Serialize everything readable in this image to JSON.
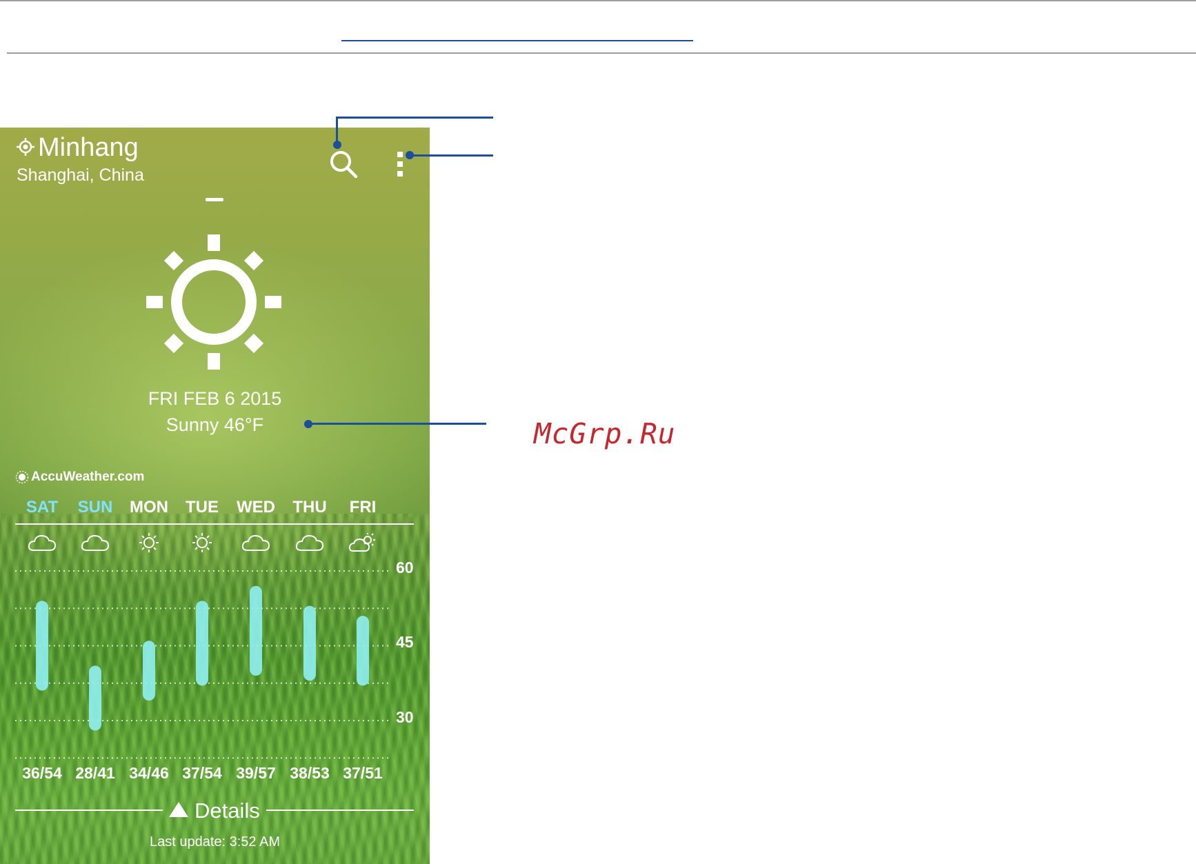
{
  "location": {
    "city": "Minhang",
    "region": "Shanghai, China"
  },
  "current": {
    "date": "FRI FEB 6 2015",
    "condition": "Sunny 46°F",
    "icon": "sun-icon"
  },
  "provider": "AccuWeather.com",
  "forecast": {
    "days": [
      {
        "label": "SAT",
        "weekend": true,
        "icon": "cloud-icon",
        "low": 36,
        "high": 54,
        "range": "36/54"
      },
      {
        "label": "SUN",
        "weekend": true,
        "icon": "cloud-icon",
        "low": 28,
        "high": 41,
        "range": "28/41"
      },
      {
        "label": "MON",
        "weekend": false,
        "icon": "sun-small-icon",
        "low": 34,
        "high": 46,
        "range": "34/46"
      },
      {
        "label": "TUE",
        "weekend": false,
        "icon": "sun-small-icon",
        "low": 37,
        "high": 54,
        "range": "37/54"
      },
      {
        "label": "WED",
        "weekend": false,
        "icon": "cloud-icon",
        "low": 39,
        "high": 57,
        "range": "39/57"
      },
      {
        "label": "THU",
        "weekend": false,
        "icon": "cloud-icon",
        "low": 38,
        "high": 53,
        "range": "38/53"
      },
      {
        "label": "FRI",
        "weekend": false,
        "icon": "partly-cloudy-icon",
        "low": 37,
        "high": 51,
        "range": "37/51"
      }
    ],
    "axis_ticks": [
      "60",
      "45",
      "30"
    ]
  },
  "details_label": "Details",
  "last_update": "Last update: 3:52 AM",
  "watermark": "McGrp.Ru",
  "colors": {
    "weekend": "#7fe3ff",
    "bar": "#8ff0f2",
    "callout": "#1b4f9c",
    "watermark": "#c8252c"
  }
}
